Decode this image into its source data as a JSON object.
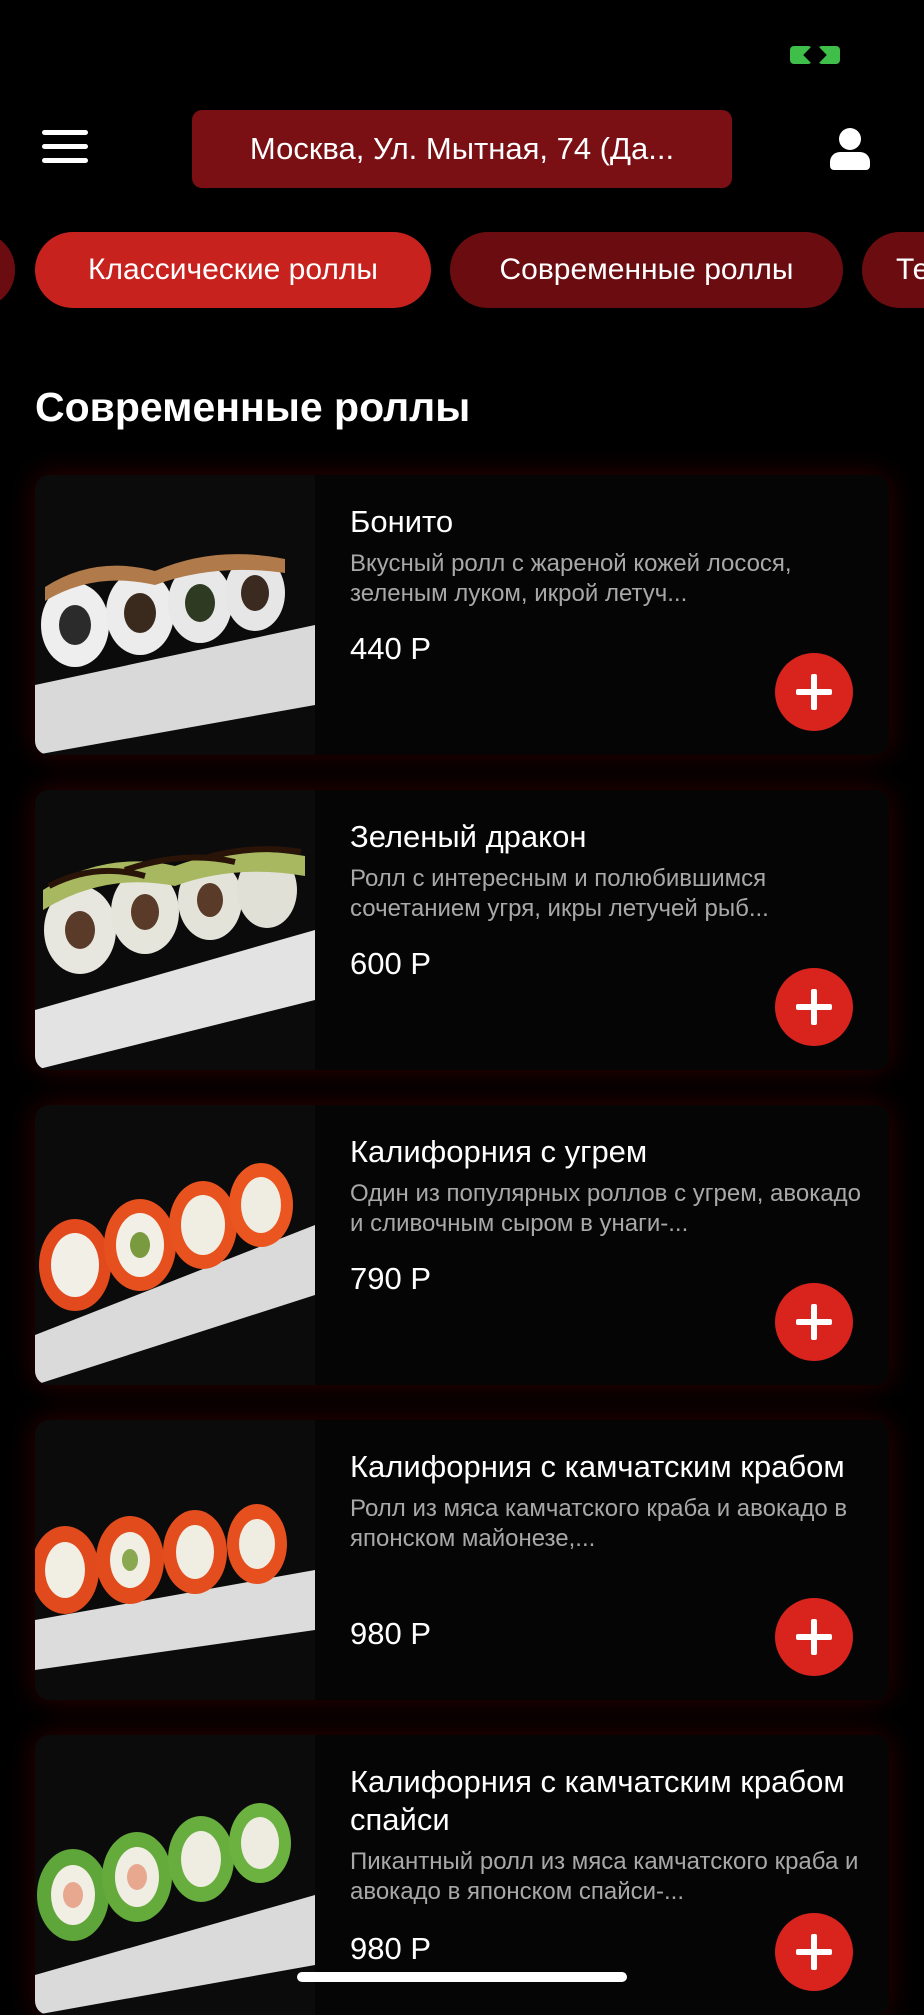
{
  "header": {
    "menu_icon": "hamburger-icon",
    "address": "Москва, Ул. Мытная, 74 (Да...",
    "profile_icon": "user-icon"
  },
  "categories": [
    {
      "label": "",
      "active": false
    },
    {
      "label": "Классические роллы",
      "active": true
    },
    {
      "label": "Современные роллы",
      "active": false
    },
    {
      "label": "Те",
      "active": false
    }
  ],
  "section": {
    "title": "Современные роллы"
  },
  "products": [
    {
      "name": "Бонито",
      "description": "Вкусный ролл с жареной кожей лосося, зеленым луком, икрой летуч...",
      "price": "440 Р"
    },
    {
      "name": "Зеленый дракон",
      "description": "Ролл с интересным и полюбившимся сочетанием угря, икры летучей рыб...",
      "price": "600 Р"
    },
    {
      "name": "Калифорния с угрем",
      "description": "Один из популярных роллов с угрем, авокадо и сливочным сыром в унаги-...",
      "price": "790 Р"
    },
    {
      "name": "Калифорния с камчатским крабом",
      "description": "Ролл из мяса камчатского краба и авокадо в японском майонезе,...",
      "price": "980 Р"
    },
    {
      "name": "Калифорния с камчатским крабом спайси",
      "description": "Пикантный ролл из мяса камчатского краба и авокадо в японском спайси-...",
      "price": "980 Р"
    }
  ],
  "colors": {
    "accent": "#d9231d",
    "tab_active": "#c8221f",
    "tab_inactive": "#6b0d10",
    "address_bg": "#7a0f14"
  }
}
